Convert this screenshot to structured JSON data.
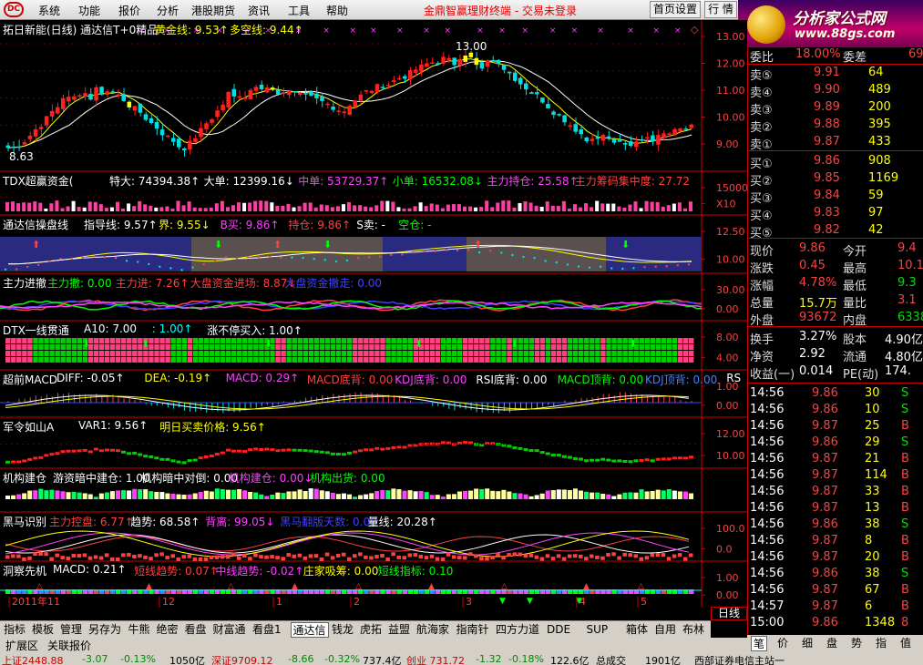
{
  "menu": {
    "items": [
      "系统",
      "功能",
      "报价",
      "分析",
      "港股期货",
      "资讯",
      "工具",
      "帮助"
    ],
    "app_title": "金鼎智赢理财终端 - 交易未登录",
    "home_settings": "首页设置",
    "quote_btn": "行 情",
    "brand_main": "分析家公式网",
    "brand_url": "www.88gs.com"
  },
  "panels": {
    "main": {
      "title": "拓日新能(日线) 通达信T+0精品",
      "inds": [
        {
          "text": "黄金线: 9.53↑",
          "color": "#ffff00"
        },
        {
          "text": "多空线: 9.44↑",
          "color": "#ffff00"
        }
      ],
      "axis": [
        "13.00",
        "12.00",
        "11.00",
        "10.00",
        "9.00"
      ],
      "low_label": "8.63",
      "high_label": "13.00"
    },
    "tdx": {
      "title": "TDX超赢资金(",
      "inds": [
        {
          "text": "特大: 74394.38↑",
          "color": "#ffffff"
        },
        {
          "text": "大单: 12399.16↓",
          "color": "#ffffff"
        },
        {
          "text": "中单: 53729.37↑",
          "color": "#ff40ff"
        },
        {
          "text": "小单: 16532.08↓",
          "color": "#00ff00"
        },
        {
          "text": "主力持仓: 25.58↑",
          "color": "#ff40ff"
        },
        {
          "text": "主力筹码集中度: 27.72",
          "color": "#ff4040"
        }
      ],
      "axis": [
        "15000",
        "X10"
      ]
    },
    "tdx2": {
      "title": "通达信操盘线",
      "inds": [
        {
          "text": "指导线: 9.57↑",
          "color": "#ffffff"
        },
        {
          "text": "界: 9.55↓",
          "color": "#ffff00"
        },
        {
          "text": "B买: 9.86↑",
          "color": "#ff40ff"
        },
        {
          "text": "持仓: 9.86↑",
          "color": "#ff4040"
        },
        {
          "text": "S卖: -",
          "color": "#ffffff"
        },
        {
          "text": "空仓: -",
          "color": "#00ff00"
        }
      ],
      "axis": [
        "12.50",
        "10.00"
      ]
    },
    "zljc": {
      "title": "主力进撤",
      "inds": [
        {
          "text": "主力撤: 0.00",
          "color": "#00ff00"
        },
        {
          "text": "主力进: 7.26↑",
          "color": "#ff4040"
        },
        {
          "text": "大盘资金进场: 8.87↓",
          "color": "#ff4040"
        },
        {
          "text": "大盘资金撤走: 0.00",
          "color": "#4040ff"
        }
      ],
      "axis": [
        "30.00",
        "0.00"
      ]
    },
    "dtx": {
      "title": "DTX一线贯通",
      "inds": [
        {
          "text": "A10: 7.00",
          "color": "#ffffff"
        },
        {
          "text": ": 1.00↑",
          "color": "#00ffff"
        },
        {
          "text": "涨不停买入: 1.00↑",
          "color": "#ffffff"
        }
      ],
      "axis": [
        "8.00",
        "4.00"
      ]
    },
    "macd": {
      "title": "超前MACD",
      "inds": [
        {
          "text": "DIFF: -0.05↑",
          "color": "#ffffff"
        },
        {
          "text": "DEA: -0.19↑",
          "color": "#ffff00"
        },
        {
          "text": "MACD: 0.29↑",
          "color": "#ff40ff"
        },
        {
          "text": "MACD底背: 0.00",
          "color": "#ff4040"
        },
        {
          "text": "KDJ底背: 0.00",
          "color": "#ff40ff"
        },
        {
          "text": "RSI底背: 0.00",
          "color": "#ffffff"
        },
        {
          "text": "MACD顶背: 0.00",
          "color": "#00ff00"
        },
        {
          "text": "KDJ顶背: 0.00",
          "color": "#4080ff"
        },
        {
          "text": "RS",
          "color": "#ffffff"
        }
      ],
      "axis": [
        "1.00",
        "0.00"
      ]
    },
    "jl": {
      "title": "军令如山A",
      "inds": [
        {
          "text": "VAR1: 9.56↑",
          "color": "#ffffff"
        },
        {
          "text": "明日买卖价格: 9.56↑",
          "color": "#ffff00"
        }
      ],
      "axis": [
        "12.00",
        "10.00"
      ]
    },
    "jg": {
      "title": "机构建仓",
      "inds": [
        {
          "text": "游资暗中建仓: 1.00",
          "color": "#ffffff"
        },
        {
          "text": "机构暗中对倒: 0.00",
          "color": "#ffffff"
        },
        {
          "text": "机构建仓: 0.00↓",
          "color": "#ff40ff"
        },
        {
          "text": "机构出货: 0.00",
          "color": "#00ff00"
        }
      ],
      "axis": []
    },
    "hm": {
      "title": "黑马识别",
      "inds": [
        {
          "text": "主力控盘: 6.77↑",
          "color": "#ff4040"
        },
        {
          "text": "趋势: 68.58↑",
          "color": "#ffffff"
        },
        {
          "text": "背离: 99.05↓",
          "color": "#ff40ff"
        },
        {
          "text": "黑马翻版天数: 0.00",
          "color": "#4040ff"
        },
        {
          "text": "量线: 20.28↑",
          "color": "#ffffff"
        }
      ],
      "axis": [
        "100.0",
        "0.0"
      ]
    },
    "dc": {
      "title": "洞察先机",
      "inds": [
        {
          "text": "MACD: 0.21↑",
          "color": "#ffffff"
        },
        {
          "text": "短线趋势: 0.07↑",
          "color": "#ff4040"
        },
        {
          "text": "中线趋势: -0.02↑",
          "color": "#ff40ff"
        },
        {
          "text": "庄家吸筹: 0.00",
          "color": "#ffff00"
        },
        {
          "text": "短线指标: 0.10",
          "color": "#00ff00"
        }
      ],
      "axis": [
        "1.00",
        "0.00"
      ]
    }
  },
  "date_axis": [
    "2011年11",
    "12",
    "1",
    "2",
    "3",
    "4",
    "5"
  ],
  "period": "日线",
  "quote": {
    "wb_label": "委比",
    "wb_val": "18.00%",
    "wc_label": "委差",
    "wc_val": "69",
    "asks": [
      {
        "label": "卖⑤",
        "price": "9.91",
        "vol": "64"
      },
      {
        "label": "卖④",
        "price": "9.90",
        "vol": "489"
      },
      {
        "label": "卖③",
        "price": "9.89",
        "vol": "200"
      },
      {
        "label": "卖②",
        "price": "9.88",
        "vol": "395"
      },
      {
        "label": "卖①",
        "price": "9.87",
        "vol": "433"
      }
    ],
    "bids": [
      {
        "label": "买①",
        "price": "9.86",
        "vol": "908"
      },
      {
        "label": "买②",
        "price": "9.85",
        "vol": "1169"
      },
      {
        "label": "买③",
        "price": "9.84",
        "vol": "59"
      },
      {
        "label": "买④",
        "price": "9.83",
        "vol": "97"
      },
      {
        "label": "买⑤",
        "price": "9.82",
        "vol": "42"
      }
    ],
    "stats": [
      {
        "l1": "现价",
        "v1": "9.86",
        "c1": "red",
        "l2": "今开",
        "v2": "9.4",
        "c2": "red"
      },
      {
        "l1": "涨跌",
        "v1": "0.45",
        "c1": "red",
        "l2": "最高",
        "v2": "10.1",
        "c2": "red"
      },
      {
        "l1": "涨幅",
        "v1": "4.78%",
        "c1": "red",
        "l2": "最低",
        "v2": "9.3",
        "c2": "green"
      },
      {
        "l1": "总量",
        "v1": "15.7万",
        "c1": "yellow",
        "l2": "量比",
        "v2": "3.1",
        "c2": "red"
      },
      {
        "l1": "外盘",
        "v1": "93672",
        "c1": "red",
        "l2": "内盘",
        "v2": "6338",
        "c2": "green"
      }
    ],
    "stats2": [
      {
        "l1": "换手",
        "v1": "3.27%",
        "l2": "股本",
        "v2": "4.90亿"
      },
      {
        "l1": "净资",
        "v1": "2.92",
        "l2": "流通",
        "v2": "4.80亿"
      },
      {
        "l1": "收益(一)",
        "v1": "0.014",
        "l2": "PE(动)",
        "v2": "174."
      }
    ],
    "ticks": [
      {
        "t": "14:56",
        "p": "9.86",
        "v": "30",
        "s": "S"
      },
      {
        "t": "14:56",
        "p": "9.86",
        "v": "10",
        "s": "S"
      },
      {
        "t": "14:56",
        "p": "9.87",
        "v": "25",
        "s": "B"
      },
      {
        "t": "14:56",
        "p": "9.86",
        "v": "29",
        "s": "S"
      },
      {
        "t": "14:56",
        "p": "9.87",
        "v": "21",
        "s": "B"
      },
      {
        "t": "14:56",
        "p": "9.87",
        "v": "114",
        "s": "B"
      },
      {
        "t": "14:56",
        "p": "9.87",
        "v": "33",
        "s": "B"
      },
      {
        "t": "14:56",
        "p": "9.87",
        "v": "13",
        "s": "B"
      },
      {
        "t": "14:56",
        "p": "9.86",
        "v": "38",
        "s": "S"
      },
      {
        "t": "14:56",
        "p": "9.87",
        "v": "8",
        "s": "B"
      },
      {
        "t": "14:56",
        "p": "9.87",
        "v": "20",
        "s": "B"
      },
      {
        "t": "14:56",
        "p": "9.86",
        "v": "38",
        "s": "S"
      },
      {
        "t": "14:56",
        "p": "9.87",
        "v": "67",
        "s": "B"
      },
      {
        "t": "14:57",
        "p": "9.87",
        "v": "6",
        "s": "B"
      },
      {
        "t": "15:00",
        "p": "9.86",
        "v": "1348",
        "s": "8"
      }
    ],
    "right_tabs": [
      "笔",
      "价",
      "细",
      "盘",
      "势",
      "指",
      "值"
    ]
  },
  "tabs": [
    "指标",
    "模板",
    "管理",
    "另存为",
    "牛熊",
    "绝密",
    "看盘",
    "财富通",
    "看盘1",
    "通达信",
    "钱龙",
    "虎拓",
    "益盟",
    "航海家",
    "指南针",
    "四方力道",
    "DDE",
    "SUP",
    "箱体",
    "自用",
    "布林"
  ],
  "tabs_active": "通达信",
  "tabs2": [
    "扩展区",
    "关联报价"
  ],
  "status": {
    "sh": "上证2448.88",
    "sh_chg": "-3.07",
    "sh_pct": "-0.13%",
    "sh_amt": "1050亿",
    "sz": "深证9709.12",
    "sz_chg": "-8.66",
    "sz_pct": "-0.32%",
    "sz_amt": "737.4亿",
    "cy": "创业 731.72",
    "cy_chg": "-1.32",
    "cy_pct": "-0.18%",
    "cy_amt": "122.6亿",
    "total": "总成交",
    "total_amt": "1901亿",
    "broker": "西部证券电信主站一"
  }
}
